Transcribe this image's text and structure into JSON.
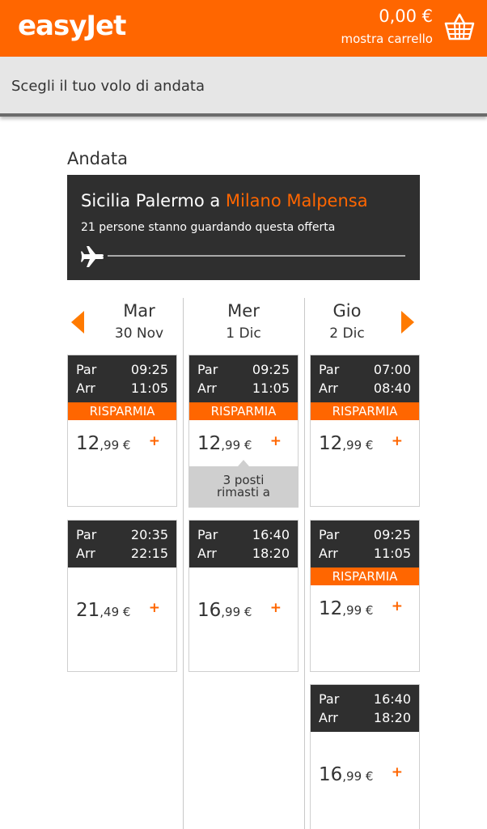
{
  "header": {
    "logo": "easyJet",
    "cart_total": "0,00 €",
    "cart_link": "mostra carrello",
    "cart_icon": "basket-icon",
    "brand_color": "#ff6600"
  },
  "subheader": {
    "title": "Scegli il tuo volo di andata"
  },
  "section": {
    "label": "Andata"
  },
  "route": {
    "origin_prefix": "Sicilia Palermo a ",
    "destination": "Milano Malpensa",
    "viewers": "21 persone stanno guardando questa offerta",
    "plane_icon": "plane-icon"
  },
  "nav": {
    "prev_icon": "arrow-left-icon",
    "next_icon": "arrow-right-icon"
  },
  "days": [
    {
      "name": "Mar",
      "date": "30 Nov",
      "flights": [
        {
          "dep_label": "Par",
          "dep": "09:25",
          "arr_label": "Arr",
          "arr": "11:05",
          "promo": "RISPARMIA",
          "price_main": "12",
          "price_small": ",99 €"
        },
        {
          "dep_label": "Par",
          "dep": "20:35",
          "arr_label": "Arr",
          "arr": "22:15",
          "promo": "",
          "price_main": "21",
          "price_small": ",49 €"
        }
      ]
    },
    {
      "name": "Mer",
      "date": "1 Dic",
      "flights": [
        {
          "dep_label": "Par",
          "dep": "09:25",
          "arr_label": "Arr",
          "arr": "11:05",
          "promo": "RISPARMIA",
          "price_main": "12",
          "price_small": ",99 €",
          "seats_line1": "3 posti",
          "seats_line2": "rimasti a"
        },
        {
          "dep_label": "Par",
          "dep": "16:40",
          "arr_label": "Arr",
          "arr": "18:20",
          "promo": "",
          "price_main": "16",
          "price_small": ",99 €"
        }
      ]
    },
    {
      "name": "Gio",
      "date": "2 Dic",
      "flights": [
        {
          "dep_label": "Par",
          "dep": "07:00",
          "arr_label": "Arr",
          "arr": "08:40",
          "promo": "RISPARMIA",
          "price_main": "12",
          "price_small": ",99 €"
        },
        {
          "dep_label": "Par",
          "dep": "09:25",
          "arr_label": "Arr",
          "arr": "11:05",
          "promo": "RISPARMIA",
          "price_main": "12",
          "price_small": ",99 €"
        },
        {
          "dep_label": "Par",
          "dep": "16:40",
          "arr_label": "Arr",
          "arr": "18:20",
          "promo": "",
          "price_main": "16",
          "price_small": ",99 €"
        }
      ]
    }
  ],
  "add_symbol": "+"
}
